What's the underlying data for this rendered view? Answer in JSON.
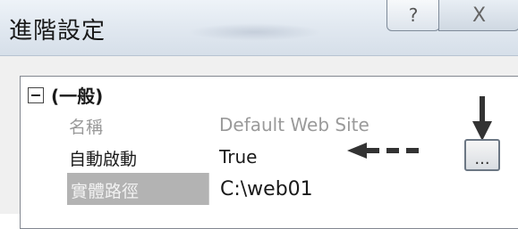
{
  "window": {
    "title": "進階設定",
    "help_label": "?",
    "close_label": "X"
  },
  "grid": {
    "category": {
      "label": "(一般)",
      "state": "expanded"
    },
    "rows": [
      {
        "name": "名稱",
        "value": "Default Web Site",
        "dimmed": true
      },
      {
        "name": "自動啟動",
        "value": "True",
        "dimmed": false
      },
      {
        "name": "實體路徑",
        "value": "C:\\web01",
        "selected": true
      }
    ],
    "browse_label": "..."
  },
  "annotations": {
    "arrow_color": "#333333"
  }
}
